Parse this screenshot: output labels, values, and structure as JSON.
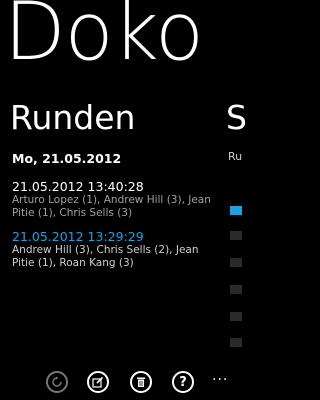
{
  "app": {
    "title": "Doko"
  },
  "pivot": {
    "current_header": "Runden",
    "next_header": "S",
    "next_sub": "Ru"
  },
  "day": {
    "label": "Mo, 21.05.2012"
  },
  "rounds": [
    {
      "timestamp": "21.05.2012 13:40:28",
      "players": "Arturo Lopez (1), Andrew Hill (3), Jean Pitie (1), Chris Sells (3)"
    },
    {
      "timestamp": "21.05.2012 13:29:29",
      "players": "Andrew Hill (3), Chris Sells (2), Jean Pitie (1), Roan Kang (3)"
    }
  ],
  "appbar": {
    "buttons": [
      {
        "icon": "refresh-icon",
        "enabled": false
      },
      {
        "icon": "edit-icon",
        "enabled": true
      },
      {
        "icon": "delete-icon",
        "enabled": true
      },
      {
        "icon": "help-icon",
        "enabled": true
      }
    ],
    "more_label": "..."
  },
  "colors": {
    "accent": "#1ba1e2",
    "background": "#000000",
    "foreground": "#ffffff",
    "subtle": "#a0a0a0"
  }
}
